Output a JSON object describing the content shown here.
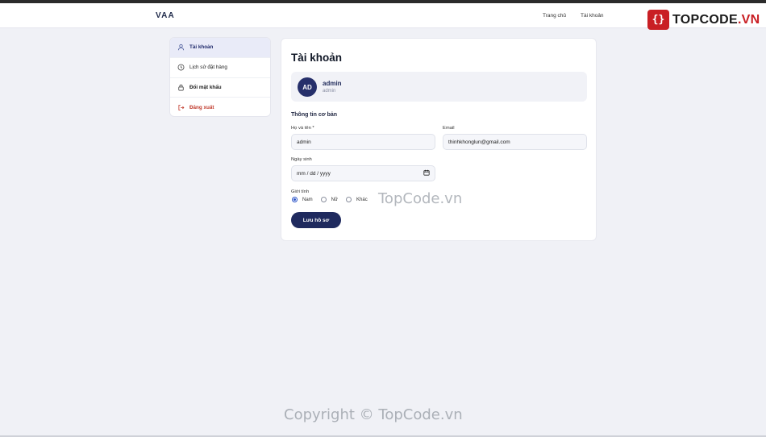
{
  "header": {
    "brand": "VAA",
    "nav": [
      {
        "label": "Trang chủ"
      },
      {
        "label": "Tài khoản"
      }
    ]
  },
  "logo": {
    "mark": "{}",
    "text_main": "TOPCODE",
    "text_suffix": ".VN"
  },
  "sidebar": {
    "items": [
      {
        "label": "Tài khoản",
        "icon": "user-icon",
        "active": true
      },
      {
        "label": "Lịch sử đặt hàng",
        "icon": "clock-icon"
      },
      {
        "label": "Đổi mật khẩu",
        "icon": "lock-icon"
      },
      {
        "label": "Đăng xuất",
        "icon": "logout-icon",
        "color": "#c0392b"
      }
    ]
  },
  "main": {
    "title": "Tài khoản",
    "profile": {
      "initials": "AD",
      "name": "admin",
      "role": "admin"
    },
    "section_title": "Thông tin cơ bản",
    "fields": {
      "name": {
        "label": "Họ và tên *",
        "value": "admin"
      },
      "email": {
        "label": "Email",
        "value": "thinhkhonglun@gmail.com"
      },
      "dob": {
        "label": "Ngày sinh",
        "placeholder": "mm / dd / yyyy"
      },
      "gender": {
        "label": "Giới tính",
        "options": [
          "Nam",
          "Nữ",
          "Khác"
        ],
        "selected": "Nam"
      }
    },
    "save_label": "Lưu hồ sơ"
  },
  "watermarks": {
    "center": "TopCode.vn",
    "bottom": "Copyright © TopCode.vn"
  },
  "colors": {
    "primary": "#1f2a5e",
    "accent": "#2b54c7",
    "danger": "#c0392b",
    "logo_red": "#c91f24"
  }
}
